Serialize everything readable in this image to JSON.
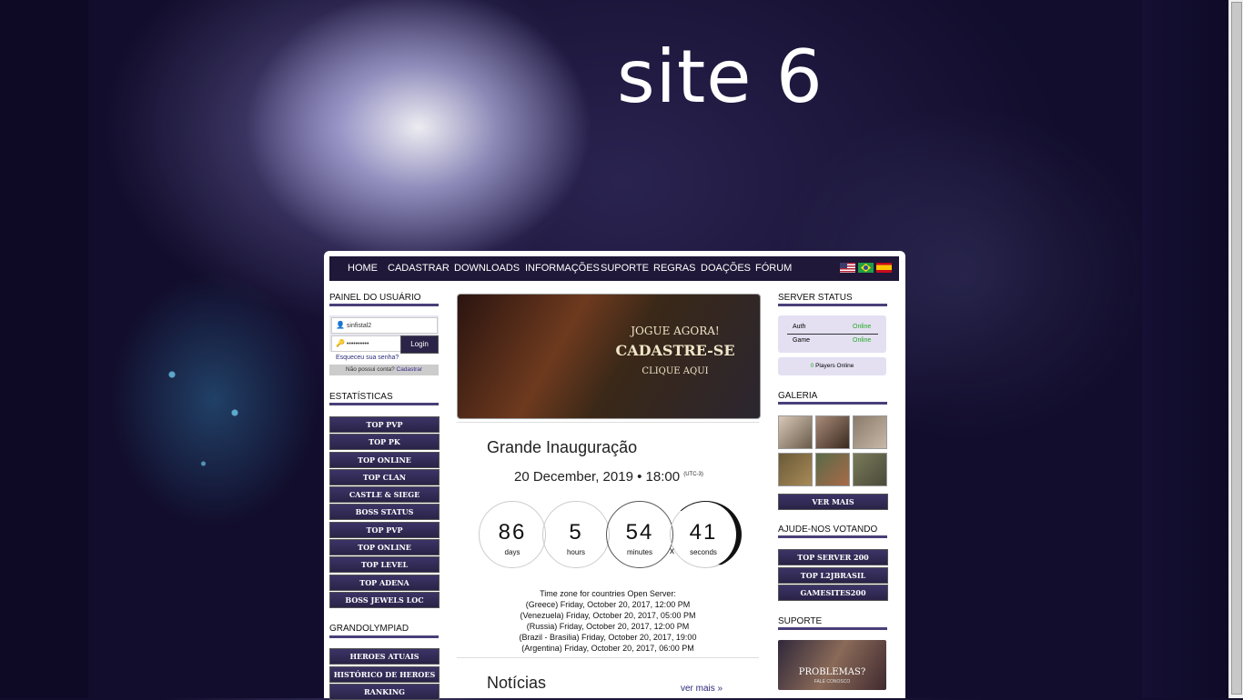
{
  "site": {
    "title": "site 6"
  },
  "nav": {
    "items": [
      "HOME",
      "CADASTRAR",
      "DOWNLOADS",
      "INFORMAÇÕES",
      "SUPORTE",
      "REGRAS",
      "DOAÇÕES",
      "FÓRUM"
    ],
    "flags": [
      "us-flag-icon",
      "br-flag-icon",
      "es-flag-icon"
    ]
  },
  "user_panel": {
    "title": "PAINEL DO USUÁRIO",
    "username_value": "sinfistal2",
    "password_value": "••••••••••",
    "login_label": "Login",
    "forgot": "Esqueceu sua senha?",
    "no_account": "Não possui conta?",
    "register_link": "Cadastrar"
  },
  "stats": {
    "title": "ESTATÍSTICAS",
    "items": [
      "TOP PVP",
      "TOP PK",
      "TOP ONLINE",
      "TOP CLAN",
      "CASTLE & SIEGE",
      "BOSS STATUS",
      "TOP PVP",
      "TOP ONLINE",
      "TOP LEVEL",
      "TOP ADENA",
      "BOSS JEWELS LOC"
    ]
  },
  "olympiad": {
    "title": "GRANDOLYMPIAD",
    "items": [
      "HEROES ATUAIS",
      "HISTÓRICO DE HEROES",
      "RANKING"
    ]
  },
  "banner": {
    "line1": "JOGUE AGORA!",
    "line2": "CADASTRE-SE",
    "line3": "CLIQUE AQUI"
  },
  "inauguration": {
    "title": "Grande Inauguração",
    "date": "20 December, 2019 • 18:00",
    "tz": "(UTC-3)",
    "countdown": [
      {
        "value": "86",
        "unit": "days"
      },
      {
        "value": "5",
        "unit": "hours"
      },
      {
        "value": "54",
        "unit": "minutes"
      },
      {
        "value": "41",
        "unit": "seconds"
      }
    ],
    "sep": "x"
  },
  "timezones": {
    "title": "Time zone for countries Open Server:",
    "lines": [
      "(Greece) Friday, October 20, 2017, 12:00 PM",
      "(Venezuela) Friday, October 20, 2017, 05:00 PM",
      "(Russia) Friday, October 20, 2017, 12:00 PM",
      "(Brazil - Brasilia) Friday, October 20, 2017, 19:00",
      "(Argentina) Friday, October 20, 2017, 06:00 PM"
    ]
  },
  "news": {
    "title": "Notícias",
    "more": "ver mais »"
  },
  "server_status": {
    "title": "SERVER STATUS",
    "rows": [
      {
        "name": "Auth",
        "status": "Online"
      },
      {
        "name": "Game",
        "status": "Online"
      }
    ],
    "players_count": "0",
    "players_label": "Players Online",
    "online_color": "#22aa22"
  },
  "gallery": {
    "title": "GALERIA",
    "more": "VER MAIS"
  },
  "vote": {
    "title": "AJUDE-NOS VOTANDO",
    "items": [
      "TOP SERVER 200",
      "TOP L2JBRASIL",
      "GAMESITES200"
    ]
  },
  "support": {
    "title": "SUPORTE",
    "banner_line1": "PROBLEMAS?",
    "banner_line2": "FALE CONOSCO"
  },
  "colors": {
    "nav_bg": "#1f1838",
    "accent": "#4a3f78"
  }
}
